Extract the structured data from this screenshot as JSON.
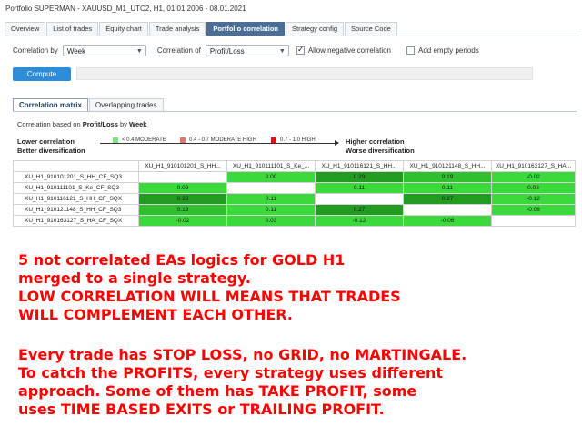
{
  "window": {
    "title": "Portfolio SUPERMAN - XAUUSD_M1_UTC2, H1, 01.01.2006 - 08.01.2021"
  },
  "tabs": [
    {
      "label": "Overview",
      "active": false
    },
    {
      "label": "List of trades",
      "active": false
    },
    {
      "label": "Equity chart",
      "active": false
    },
    {
      "label": "Trade analysis",
      "active": false
    },
    {
      "label": "Portfolio correlation",
      "active": true
    },
    {
      "label": "Strategy config",
      "active": false
    },
    {
      "label": "Source Code",
      "active": false
    }
  ],
  "controls": {
    "correlation_by_label": "Correlation by",
    "correlation_by_value": "Week",
    "correlation_of_label": "Correlation of",
    "correlation_of_value": "Profit/Loss",
    "allow_negative_label": "Allow negative correlation",
    "allow_negative_checked": true,
    "add_empty_label": "Add empty periods",
    "add_empty_checked": false,
    "compute_label": "Compute",
    "progress": 0
  },
  "subtabs": [
    {
      "label": "Correlation matrix",
      "active": true
    },
    {
      "label": "Overlapping trades",
      "active": false
    }
  ],
  "basis": {
    "prefix": "Correlation based on",
    "measure": "Profit/Loss",
    "by": "by",
    "period": "Week"
  },
  "legend": {
    "left_line1": "Lower correlation",
    "left_line2": "Better diversification",
    "right_line1": "Higher correlation",
    "right_line2": "Worse diversification",
    "items": [
      {
        "label": "< 0.4 MODERATE",
        "color": "#7fe07f"
      },
      {
        "label": "0.4 - 0.7 MODERATE HIGH",
        "color": "#e8736b"
      },
      {
        "label": "0.7 - 1.0 HIGH",
        "color": "#e01010"
      }
    ]
  },
  "matrix": {
    "columns": [
      "XU_H1_910101201_S_HH...",
      "XU_H1_910111101_S_Ke_...",
      "XU_H1_910116121_S_HH...",
      "XU_H1_910121148_S_HH...",
      "XU_H1_910163127_S_HA..."
    ],
    "rows": [
      {
        "name": "XU_H1_910101201_S_HH_CF_SQ3",
        "values": [
          "",
          "0.09",
          "0.29",
          "0.19",
          "-0.02"
        ]
      },
      {
        "name": "XU_H1_910111101_S_Ke_CF_SQ3",
        "values": [
          "0.09",
          "",
          "0.11",
          "0.11",
          "0.03"
        ]
      },
      {
        "name": "XU_H1_910116121_S_HH_CF_SQX",
        "values": [
          "0.29",
          "0.11",
          "",
          "0.27",
          "-0.12"
        ]
      },
      {
        "name": "XU_H1_910121148_S_HH_CF_SQ3",
        "values": [
          "0.19",
          "0.11",
          "0.27",
          "",
          "-0.06"
        ]
      },
      {
        "name": "XU_H1_910163127_S_HA_CF_SQX",
        "values": [
          "-0.02",
          "0.03",
          "-0.12",
          "-0.06",
          ""
        ]
      }
    ],
    "colors": {
      "low": "#3cd93c",
      "mid": "#2fbf2f",
      "dark": "#219c21"
    }
  },
  "overlay_text": {
    "line1": "5 not correlated EAs logics for GOLD H1",
    "line2": "merged to a single strategy.",
    "line3": "LOW CORRELATION WILL MEANS THAT TRADES",
    "line4": "WILL COMPLEMENT EACH OTHER.",
    "line5": "Every trade has STOP LOSS, no GRID, no MARTINGALE.",
    "line6": "To catch the PROFITS, every strategy uses different",
    "line7": "approach. Some of them has TAKE PROFIT, some",
    "line8": "uses TIME BASED EXITS or TRAILING PROFIT."
  }
}
